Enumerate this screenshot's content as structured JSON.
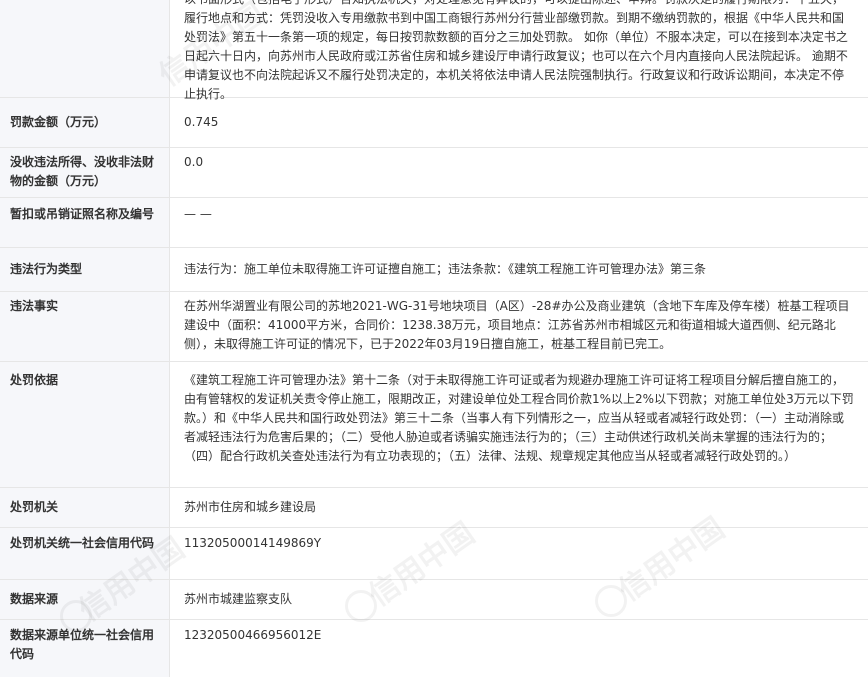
{
  "header_text": "以书面形式（包括电子形式）告知执法机关，对处理意见有异议的，可以提出陈述、申辩。罚款决定的履行期限为：十五天，履行地点和方式：凭罚没收入专用缴款书到中国工商银行苏州分行营业部缴罚款。到期不缴纳罚款的，根据《中华人民共和国处罚法》第五十一条第一项的规定，每日按罚款数额的百分之三加处罚款。 如你（单位）不服本决定，可以在接到本决定书之日起六十日内，向苏州市人民政府或江苏省住房和城乡建设厅申请行政复议；也可以在六个月内直接向人民法院起诉。 逾期不申请复议也不向法院起诉又不履行处罚决定的，本机关将依法申请人民法院强制执行。行政复议和行政诉讼期间，本决定不停止执行。",
  "rows": [
    {
      "label": "罚款金额（万元）",
      "value": "0.745"
    },
    {
      "label": "没收违法所得、没收非法财物的金额（万元）",
      "value": "0.0"
    },
    {
      "label": "暂扣或吊销证照名称及编号",
      "value": "— —"
    },
    {
      "label": "违法行为类型",
      "value": "违法行为：施工单位未取得施工许可证擅自施工；违法条款：《建筑工程施工许可管理办法》第三条"
    },
    {
      "label": "违法事实",
      "value": "在苏州华湖置业有限公司的苏地2021-WG-31号地块项目（A区）-28#办公及商业建筑（含地下车库及停车楼）桩基工程项目建设中（面积：41000平方米，合同价：1238.38万元，项目地点：江苏省苏州市相城区元和街道相城大道西侧、纪元路北侧），未取得施工许可证的情况下，已于2022年03月19日擅自施工，桩基工程目前已完工。"
    },
    {
      "label": "处罚依据",
      "value": "《建筑工程施工许可管理办法》第十二条（对于未取得施工许可证或者为规避办理施工许可证将工程项目分解后擅自施工的，由有管辖权的发证机关责令停止施工，限期改正，对建设单位处工程合同价款1%以上2%以下罚款；对施工单位处3万元以下罚款。）和《中华人民共和国行政处罚法》第三十二条（当事人有下列情形之一，应当从轻或者减轻行政处罚：（一）主动消除或者减轻违法行为危害后果的；（二）受他人胁迫或者诱骗实施违法行为的；（三）主动供述行政机关尚未掌握的违法行为的；（四）配合行政机关查处违法行为有立功表现的；（五）法律、法规、规章规定其他应当从轻或者减轻行政处罚的。）"
    },
    {
      "label": "处罚机关",
      "value": "苏州市住房和城乡建设局"
    },
    {
      "label": "处罚机关统一社会信用代码",
      "value": "11320500014149869Y"
    },
    {
      "label": "数据来源",
      "value": "苏州市城建监察支队"
    },
    {
      "label": "数据来源单位统一社会信用代码",
      "value": "12320500466956012E"
    }
  ],
  "watermark": "信用中国"
}
